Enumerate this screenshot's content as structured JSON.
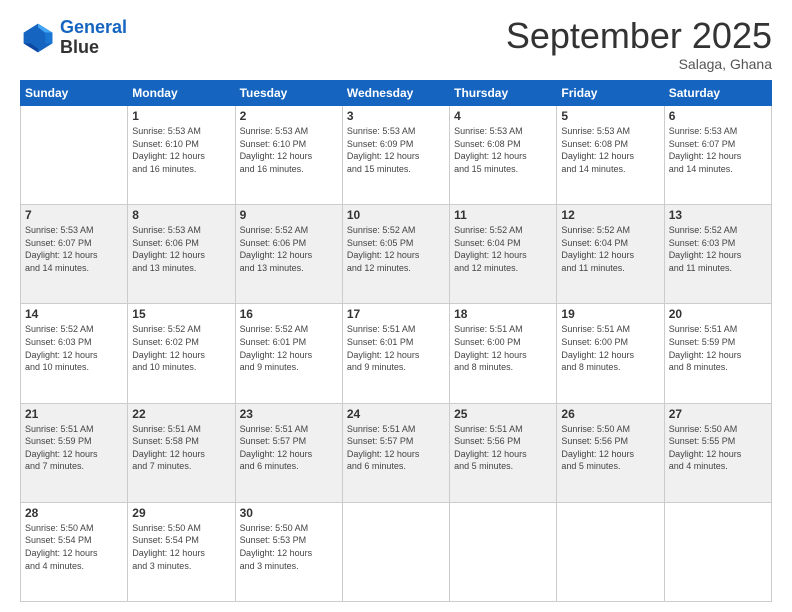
{
  "logo": {
    "line1": "General",
    "line2": "Blue"
  },
  "title": "September 2025",
  "location": "Salaga, Ghana",
  "days_of_week": [
    "Sunday",
    "Monday",
    "Tuesday",
    "Wednesday",
    "Thursday",
    "Friday",
    "Saturday"
  ],
  "weeks": [
    [
      {
        "day": "",
        "info": ""
      },
      {
        "day": "1",
        "info": "Sunrise: 5:53 AM\nSunset: 6:10 PM\nDaylight: 12 hours\nand 16 minutes."
      },
      {
        "day": "2",
        "info": "Sunrise: 5:53 AM\nSunset: 6:10 PM\nDaylight: 12 hours\nand 16 minutes."
      },
      {
        "day": "3",
        "info": "Sunrise: 5:53 AM\nSunset: 6:09 PM\nDaylight: 12 hours\nand 15 minutes."
      },
      {
        "day": "4",
        "info": "Sunrise: 5:53 AM\nSunset: 6:08 PM\nDaylight: 12 hours\nand 15 minutes."
      },
      {
        "day": "5",
        "info": "Sunrise: 5:53 AM\nSunset: 6:08 PM\nDaylight: 12 hours\nand 14 minutes."
      },
      {
        "day": "6",
        "info": "Sunrise: 5:53 AM\nSunset: 6:07 PM\nDaylight: 12 hours\nand 14 minutes."
      }
    ],
    [
      {
        "day": "7",
        "info": "Sunrise: 5:53 AM\nSunset: 6:07 PM\nDaylight: 12 hours\nand 14 minutes."
      },
      {
        "day": "8",
        "info": "Sunrise: 5:53 AM\nSunset: 6:06 PM\nDaylight: 12 hours\nand 13 minutes."
      },
      {
        "day": "9",
        "info": "Sunrise: 5:52 AM\nSunset: 6:06 PM\nDaylight: 12 hours\nand 13 minutes."
      },
      {
        "day": "10",
        "info": "Sunrise: 5:52 AM\nSunset: 6:05 PM\nDaylight: 12 hours\nand 12 minutes."
      },
      {
        "day": "11",
        "info": "Sunrise: 5:52 AM\nSunset: 6:04 PM\nDaylight: 12 hours\nand 12 minutes."
      },
      {
        "day": "12",
        "info": "Sunrise: 5:52 AM\nSunset: 6:04 PM\nDaylight: 12 hours\nand 11 minutes."
      },
      {
        "day": "13",
        "info": "Sunrise: 5:52 AM\nSunset: 6:03 PM\nDaylight: 12 hours\nand 11 minutes."
      }
    ],
    [
      {
        "day": "14",
        "info": "Sunrise: 5:52 AM\nSunset: 6:03 PM\nDaylight: 12 hours\nand 10 minutes."
      },
      {
        "day": "15",
        "info": "Sunrise: 5:52 AM\nSunset: 6:02 PM\nDaylight: 12 hours\nand 10 minutes."
      },
      {
        "day": "16",
        "info": "Sunrise: 5:52 AM\nSunset: 6:01 PM\nDaylight: 12 hours\nand 9 minutes."
      },
      {
        "day": "17",
        "info": "Sunrise: 5:51 AM\nSunset: 6:01 PM\nDaylight: 12 hours\nand 9 minutes."
      },
      {
        "day": "18",
        "info": "Sunrise: 5:51 AM\nSunset: 6:00 PM\nDaylight: 12 hours\nand 8 minutes."
      },
      {
        "day": "19",
        "info": "Sunrise: 5:51 AM\nSunset: 6:00 PM\nDaylight: 12 hours\nand 8 minutes."
      },
      {
        "day": "20",
        "info": "Sunrise: 5:51 AM\nSunset: 5:59 PM\nDaylight: 12 hours\nand 8 minutes."
      }
    ],
    [
      {
        "day": "21",
        "info": "Sunrise: 5:51 AM\nSunset: 5:59 PM\nDaylight: 12 hours\nand 7 minutes."
      },
      {
        "day": "22",
        "info": "Sunrise: 5:51 AM\nSunset: 5:58 PM\nDaylight: 12 hours\nand 7 minutes."
      },
      {
        "day": "23",
        "info": "Sunrise: 5:51 AM\nSunset: 5:57 PM\nDaylight: 12 hours\nand 6 minutes."
      },
      {
        "day": "24",
        "info": "Sunrise: 5:51 AM\nSunset: 5:57 PM\nDaylight: 12 hours\nand 6 minutes."
      },
      {
        "day": "25",
        "info": "Sunrise: 5:51 AM\nSunset: 5:56 PM\nDaylight: 12 hours\nand 5 minutes."
      },
      {
        "day": "26",
        "info": "Sunrise: 5:50 AM\nSunset: 5:56 PM\nDaylight: 12 hours\nand 5 minutes."
      },
      {
        "day": "27",
        "info": "Sunrise: 5:50 AM\nSunset: 5:55 PM\nDaylight: 12 hours\nand 4 minutes."
      }
    ],
    [
      {
        "day": "28",
        "info": "Sunrise: 5:50 AM\nSunset: 5:54 PM\nDaylight: 12 hours\nand 4 minutes."
      },
      {
        "day": "29",
        "info": "Sunrise: 5:50 AM\nSunset: 5:54 PM\nDaylight: 12 hours\nand 3 minutes."
      },
      {
        "day": "30",
        "info": "Sunrise: 5:50 AM\nSunset: 5:53 PM\nDaylight: 12 hours\nand 3 minutes."
      },
      {
        "day": "",
        "info": ""
      },
      {
        "day": "",
        "info": ""
      },
      {
        "day": "",
        "info": ""
      },
      {
        "day": "",
        "info": ""
      }
    ]
  ]
}
